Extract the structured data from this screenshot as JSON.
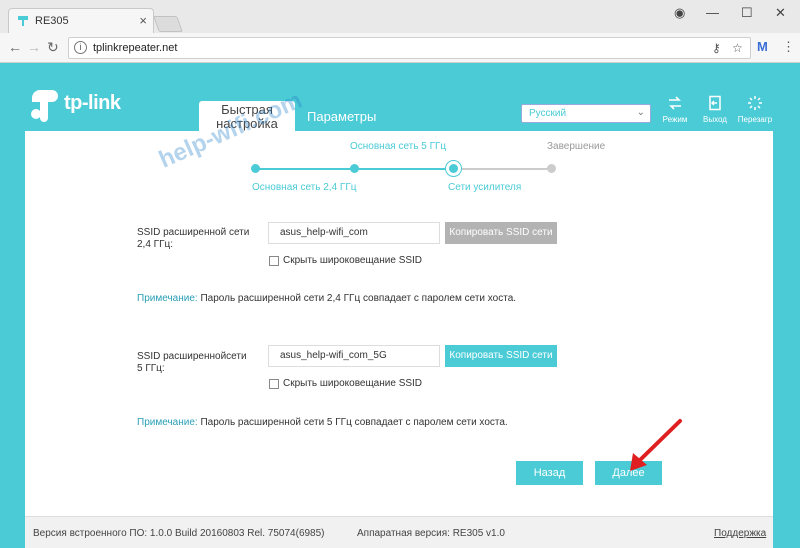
{
  "browser": {
    "tab_title": "RE305",
    "tab_close": "×",
    "url": "tplinkrepeater.net",
    "url_info_glyph": "i",
    "key_glyph": "⚷",
    "star_glyph": "☆",
    "menu_glyph": "⋮",
    "ext_glyph": "M",
    "back_glyph": "←",
    "forward_glyph": "→",
    "reload_glyph": "↻",
    "account_glyph": "◉",
    "minimize_glyph": "—",
    "maximize_glyph": "☐",
    "close_glyph": "✕"
  },
  "header": {
    "logo_text": "tp-link",
    "tab_quick_label_1": "Быстрая",
    "tab_quick_label_2": "настройка",
    "tab_params_label": "Параметры",
    "language": "Русский",
    "lang_arrow": "⌄",
    "tools": [
      {
        "label": "Режим",
        "icon": "mode-icon"
      },
      {
        "label": "Выход",
        "icon": "logout-icon"
      },
      {
        "label": "Перезагр",
        "icon": "reboot-icon"
      }
    ]
  },
  "progress": {
    "steps": [
      {
        "label": "Основная сеть 2,4 ГГц",
        "state": "done"
      },
      {
        "label": "Основная сеть 5 ГГц",
        "state": "done"
      },
      {
        "label": "Сети усилителя",
        "state": "current"
      },
      {
        "label": "Завершение",
        "state": "todo"
      }
    ]
  },
  "watermark": "help-wifi.com",
  "form": {
    "ssid24_label_1": "SSID расширенной сети",
    "ssid24_label_2": "2,4 ГГц:",
    "ssid24_value": "asus_help-wifi_com",
    "copy24_label": "Копировать SSID сети",
    "hide24_label": "Скрыть широковещание SSID",
    "note24_key": "Примечание:",
    "note24_text": "Пароль расширенной сети 2,4 ГГц совпадает с паролем сети хоста.",
    "ssid5_label_1": "SSID расширеннойсети",
    "ssid5_label_2": "5 ГГц:",
    "ssid5_value": "asus_help-wifi_com_5G",
    "copy5_label": "Копировать SSID сети",
    "hide5_label": "Скрыть широковещание SSID",
    "note5_key": "Примечание:",
    "note5_text": "Пароль расширенной сети 5 ГГц совпадает с паролем сети хоста.",
    "back_label": "Назад",
    "next_label": "Далее"
  },
  "footer": {
    "firmware": "Версия встроенного ПО: 1.0.0 Build 20160803 Rel. 75074(6985)",
    "hardware": "Аппаратная версия: RE305 v1.0",
    "support": "Поддержка"
  },
  "colors": {
    "accent": "#4acbd6",
    "copy_disabled": "#b3b3b3",
    "arrow": "#e02020",
    "pending": "#cccccc"
  }
}
